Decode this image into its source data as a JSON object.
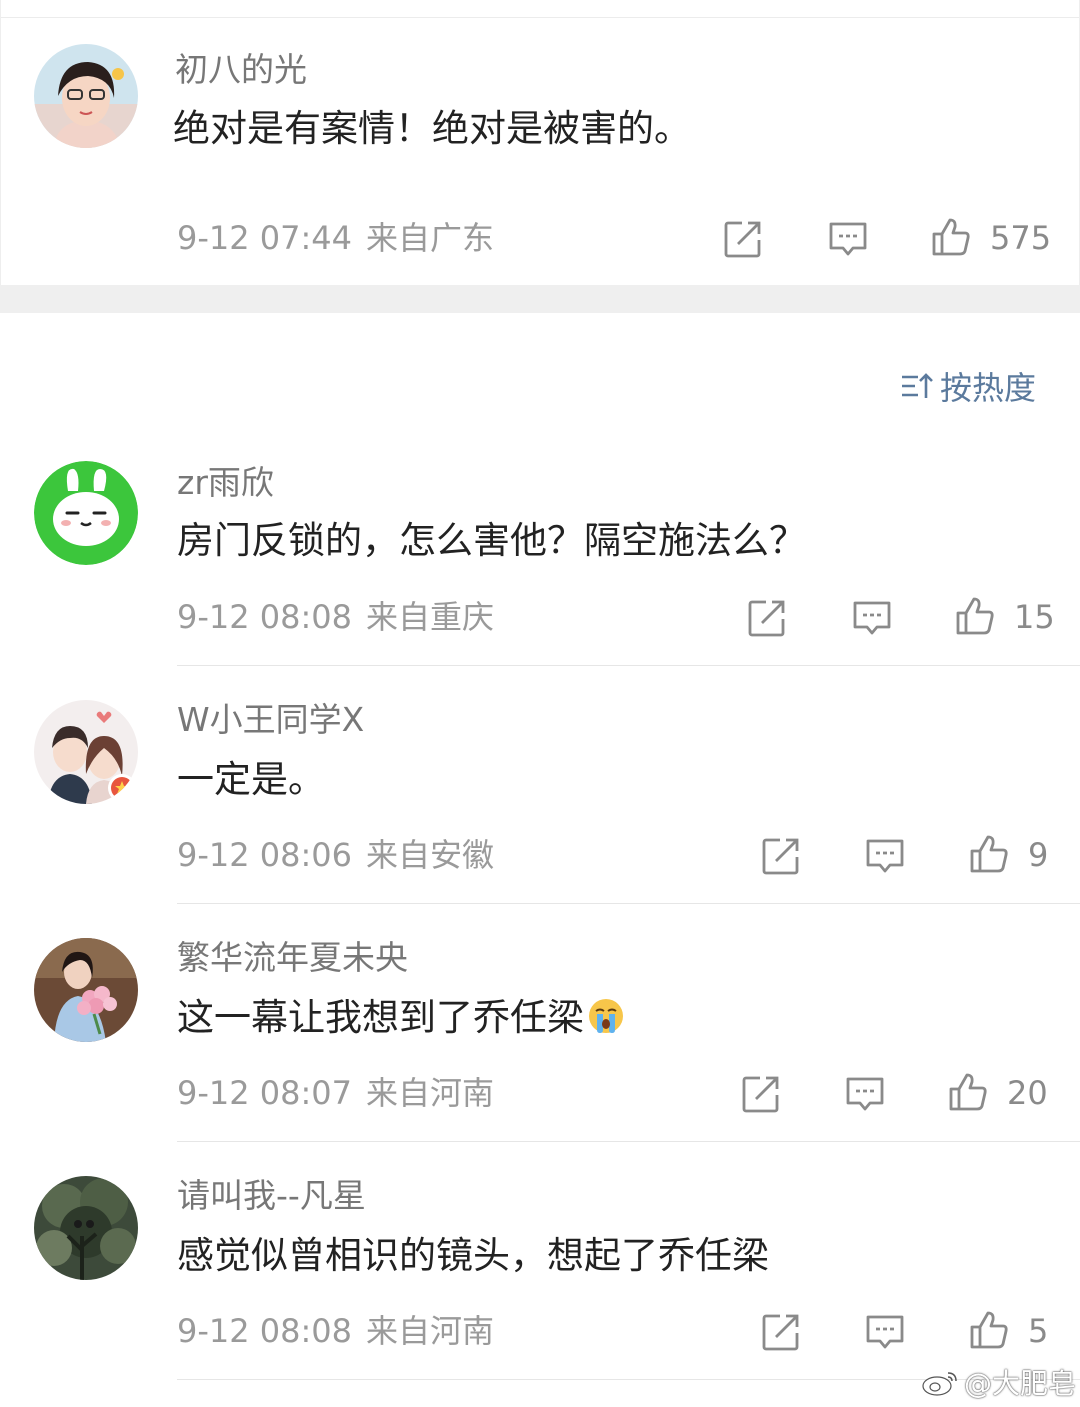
{
  "colors": {
    "text_primary": "#222222",
    "text_secondary": "#9a9a9a",
    "username": "#777777",
    "accent_link": "#5b7a9d",
    "section_gap": "#efefef"
  },
  "top_post": {
    "username": "初八的光",
    "text": "绝对是有案情！绝对是被害的。",
    "time": "9-12 07:44",
    "location": "来自广东",
    "likes": "575",
    "avatar_icon": "woman-photo-avatar"
  },
  "sort": {
    "label": "按热度",
    "icon": "sort-icon"
  },
  "comments": [
    {
      "username": "zr雨欣",
      "text": "房门反锁的，怎么害他？隔空施法么？",
      "time": "9-12 08:08",
      "location": "来自重庆",
      "likes": "15",
      "avatar_icon": "green-bunny-avatar"
    },
    {
      "username": "W小王同学X",
      "text": "一定是。",
      "time": "9-12 08:06",
      "location": "来自安徽",
      "likes": "9",
      "avatar_icon": "couple-cartoon-avatar"
    },
    {
      "username": "繁华流年夏未央",
      "text": "这一幕让我想到了乔任梁",
      "emoji": "crying-face-icon",
      "time": "9-12 08:07",
      "location": "来自河南",
      "likes": "20",
      "avatar_icon": "woman-flowers-avatar"
    },
    {
      "username": "请叫我--凡星",
      "text": "感觉似曾相识的镜头，想起了乔任梁",
      "time": "9-12 08:08",
      "location": "来自河南",
      "likes": "5",
      "avatar_icon": "dark-tree-avatar"
    }
  ],
  "watermark": {
    "text": "@大肥皂",
    "icon": "weibo-logo-icon"
  }
}
